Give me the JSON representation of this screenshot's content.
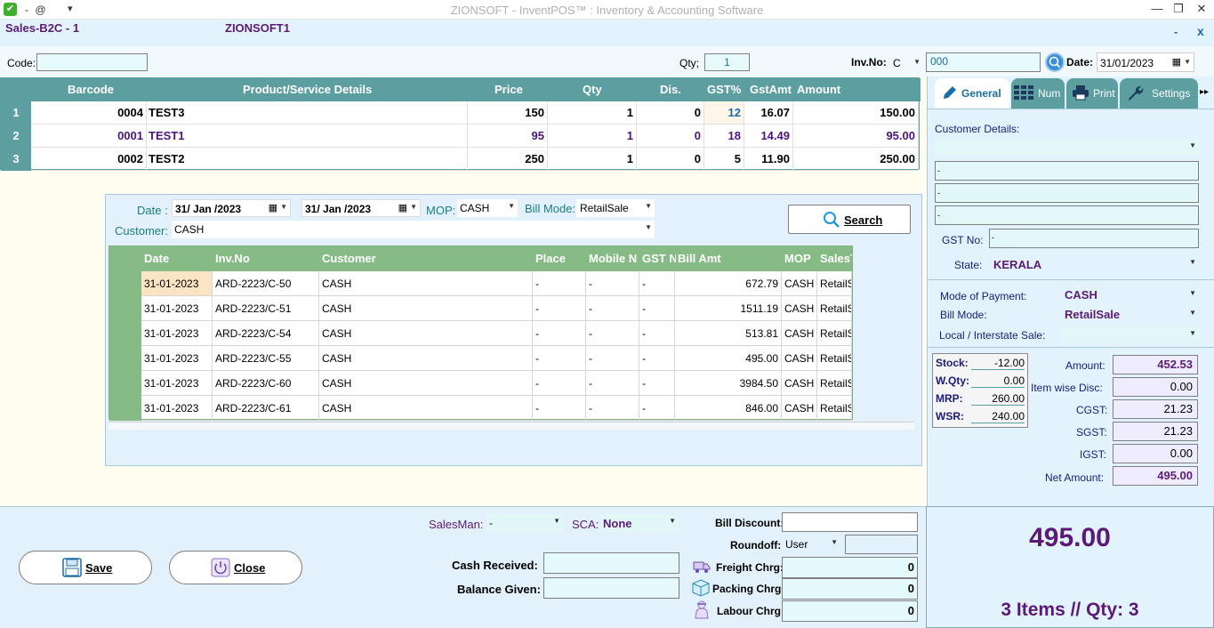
{
  "window": {
    "title": "ZIONSOFT - InventPOS™ : Inventory & Accounting Software",
    "quick_access": "- @",
    "minimize": "—",
    "restore": "❐",
    "close": "✕"
  },
  "header": {
    "form_title": "Sales-B2C - 1",
    "company": "ZIONSOFT1",
    "min_label": "-",
    "close_label": "x"
  },
  "coderow": {
    "code_label": "Code:",
    "code_value": "",
    "qty_label": "Qty;",
    "qty_value": "1",
    "invno_label": "Inv.No:",
    "invno_prefix": "C",
    "invno_value": "000",
    "date_label": "Date:",
    "date_value": "31/01/2023"
  },
  "items_grid": {
    "headers": [
      "Barcode",
      "Product/Service Details",
      "Price",
      "Qty",
      "Dis.",
      "GST%",
      "GstAmt",
      "Amount"
    ],
    "rows": [
      {
        "n": "1",
        "barcode": "0004",
        "product": "TEST3",
        "price": "150",
        "qty": "1",
        "dis": "0",
        "gst": "12",
        "gstamt": "16.07",
        "amount": "150.00"
      },
      {
        "n": "2",
        "barcode": "0001",
        "product": "TEST1",
        "price": "95",
        "qty": "1",
        "dis": "0",
        "gst": "18",
        "gstamt": "14.49",
        "amount": "95.00"
      },
      {
        "n": "3",
        "barcode": "0002",
        "product": "TEST2",
        "price": "250",
        "qty": "1",
        "dis": "0",
        "gst": "5",
        "gstamt": "11.90",
        "amount": "250.00"
      }
    ]
  },
  "search_panel": {
    "date_label": "Date :",
    "date_from": "31/ Jan /2023",
    "date_to": "31/ Jan /2023",
    "mop_label": "MOP:",
    "mop_value": "CASH",
    "billmode_label": "Bill Mode:",
    "billmode_value": "RetailSale",
    "customer_label": "Customer:",
    "customer_value": "CASH",
    "search_label": "Search",
    "headers": [
      "Date",
      "Inv.No",
      "Customer",
      "Place",
      "Mobile N",
      "GST N",
      "Bill Amt",
      "MOP",
      "SalesT"
    ],
    "rows": [
      {
        "date": "31-01-2023",
        "inv": "ARD-2223/C-50",
        "cust": "CASH",
        "place": "-",
        "mobile": "-",
        "gst": "-",
        "amt": "672.79",
        "mop": "CASH",
        "st": "RetailS"
      },
      {
        "date": "31-01-2023",
        "inv": "ARD-2223/C-51",
        "cust": "CASH",
        "place": "-",
        "mobile": "-",
        "gst": "-",
        "amt": "1511.19",
        "mop": "CASH",
        "st": "RetailS"
      },
      {
        "date": "31-01-2023",
        "inv": "ARD-2223/C-54",
        "cust": "CASH",
        "place": "-",
        "mobile": "-",
        "gst": "-",
        "amt": "513.81",
        "mop": "CASH",
        "st": "RetailS"
      },
      {
        "date": "31-01-2023",
        "inv": "ARD-2223/C-55",
        "cust": "CASH",
        "place": "-",
        "mobile": "-",
        "gst": "-",
        "amt": "495.00",
        "mop": "CASH",
        "st": "RetailS"
      },
      {
        "date": "31-01-2023",
        "inv": "ARD-2223/C-60",
        "cust": "CASH",
        "place": "-",
        "mobile": "-",
        "gst": "-",
        "amt": "3984.50",
        "mop": "CASH",
        "st": "RetailS"
      },
      {
        "date": "31-01-2023",
        "inv": "ARD-2223/C-61",
        "cust": "CASH",
        "place": "-",
        "mobile": "-",
        "gst": "-",
        "amt": "846.00",
        "mop": "CASH",
        "st": "RetailS"
      }
    ]
  },
  "right_panel": {
    "tabs": [
      "General",
      "Num",
      "Print",
      "Settings"
    ],
    "more": "▸▸",
    "customer_details_label": "Customer Details:",
    "addr1": "-",
    "addr2": "-",
    "addr3": "-",
    "gst_label": "GST No:",
    "gst_value": "-",
    "state_label": "State:",
    "state_value": "KERALA",
    "mop_label": "Mode of Payment:",
    "mop_value": "CASH",
    "billmode_label": "Bill Mode:",
    "billmode_value": "RetailSale",
    "local_label": "Local / Interstate Sale:",
    "local_value": "",
    "stock_label": "Stock:",
    "stock_value": "-12.00",
    "wqty_label": "W.Qty:",
    "wqty_value": "0.00",
    "mrp_label": "MRP:",
    "mrp_value": "260.00",
    "wsr_label": "WSR:",
    "wsr_value": "240.00",
    "amount_label": "Amount:",
    "amount_value": "452.53",
    "disc_label": "Item wise Disc:",
    "disc_value": "0.00",
    "cgst_label": "CGST:",
    "cgst_value": "21.23",
    "sgst_label": "SGST:",
    "sgst_value": "21.23",
    "igst_label": "IGST:",
    "igst_value": "0.00",
    "net_label": "Net Amount:",
    "net_value": "495.00"
  },
  "bottom": {
    "save_label": "Save",
    "close_label": "Close",
    "salesman_label": "SalesMan:",
    "salesman_value": "-",
    "sca_label": "SCA:",
    "sca_value": "None",
    "cash_received_label": "Cash Received:",
    "cash_received_value": "",
    "balance_label": "Balance Given:",
    "balance_value": "",
    "bill_discount_label": "Bill Discount:",
    "bill_discount_value": "",
    "roundoff_label": "Roundoff:",
    "roundoff_mode": "User",
    "roundoff_value": "",
    "freight_label": "Freight Chrg:",
    "freight_value": "0",
    "packing_label": "Packing Chrg:",
    "packing_value": "0",
    "labour_label": "Labour Chrg:",
    "labour_value": "0"
  },
  "totals": {
    "grand_total": "495.00",
    "summary": "3 Items //  Qty: 3"
  }
}
